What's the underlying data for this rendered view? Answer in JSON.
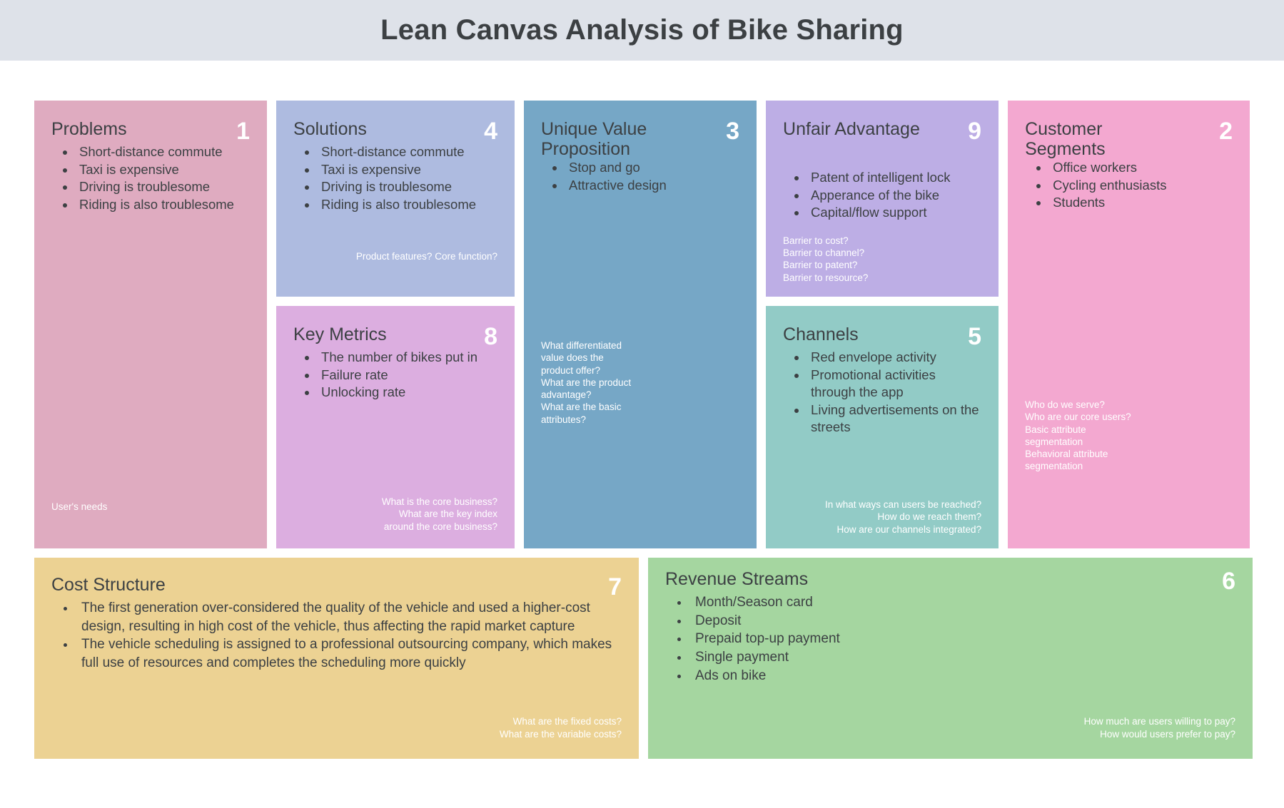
{
  "header": {
    "title": "Lean Canvas Analysis of Bike Sharing",
    "background": "#dee2e9"
  },
  "panels": {
    "problems": {
      "title": "Problems",
      "number": "1",
      "color": "#dfabc0",
      "items": [
        "Short-distance commute",
        "Taxi is expensive",
        "Driving is troublesome",
        "Riding is also troublesome"
      ],
      "notes": [
        "User's needs"
      ],
      "notes_align": "bottom-left"
    },
    "solutions": {
      "title": "Solutions",
      "number": "4",
      "color": "#aebbe0",
      "items": [
        "Short-distance commute",
        "Taxi is expensive",
        "Driving is troublesome",
        "Riding is also troublesome"
      ],
      "notes": [
        "Product features? Core function?"
      ],
      "notes_align": "bottom-right"
    },
    "key_metrics": {
      "title": "Key Metrics",
      "number": "8",
      "color": "#dcaee0",
      "items": [
        "The number of bikes put in",
        "Failure rate",
        "Unlocking rate"
      ],
      "notes": [
        "What is the core business?",
        "What are the key index\naround the core business?"
      ],
      "notes_align": "bottom-right"
    },
    "unique_value_proposition": {
      "title": "Unique Value Proposition",
      "number": "3",
      "color": "#76a7c6",
      "items": [
        "Stop and go",
        "Attractive design"
      ],
      "notes": [
        "What differentiated\nvalue does the\nproduct offer?",
        "What are the product\nadvantage?",
        "What are the basic\nattributes?"
      ],
      "notes_align": "middle-left"
    },
    "unfair_advantage": {
      "title": "Unfair Advantage",
      "number": "9",
      "color": "#bdaee5",
      "items": [
        "Patent of intelligent lock",
        "Apperance of the bike",
        "Capital/flow support"
      ],
      "notes": [
        "Barrier to cost?",
        "Barrier to channel?",
        "Barrier to patent?",
        "Barrier to resource?"
      ],
      "notes_align": "bottom-left"
    },
    "channels": {
      "title": "Channels",
      "number": "5",
      "color": "#92cbc6",
      "items": [
        "Red envelope activity",
        "Promotional activities through the app",
        "Living advertisements on the streets"
      ],
      "notes": [
        "In what ways can users be reached?",
        "How do we reach them?",
        "How are our channels integrated?"
      ],
      "notes_align": "bottom-right"
    },
    "customer_segments": {
      "title": "Customer Segments",
      "number": "2",
      "color": "#f3a8d0",
      "items": [
        "Office workers",
        "Cycling enthusiasts",
        "Students"
      ],
      "notes": [
        "Who do we serve?",
        "Who are our core users?",
        "Basic attribute\nsegmentation",
        "Behavioral attribute\nsegmentation"
      ],
      "notes_align": "middle-left"
    },
    "cost_structure": {
      "title": "Cost Structure",
      "number": "7",
      "color": "#ecd293",
      "items": [
        "The first generation over-considered the quality of the vehicle and used a higher-cost design, resulting in high cost of the vehicle, thus affecting the rapid market capture",
        "The vehicle scheduling is assigned to a professional outsourcing company, which makes full use of resources and completes the scheduling more quickly"
      ],
      "notes": [
        "What are the fixed costs?",
        "What are the variable costs?"
      ],
      "notes_align": "bottom-right"
    },
    "revenue_streams": {
      "title": "Revenue Streams",
      "number": "6",
      "color": "#a5d6a0",
      "items": [
        "Month/Season card",
        "Deposit",
        "Prepaid top-up payment",
        "Single payment",
        "Ads on bike"
      ],
      "notes": [
        "How much are users willing to pay?",
        "How would users prefer to pay?"
      ],
      "notes_align": "bottom-right"
    }
  }
}
